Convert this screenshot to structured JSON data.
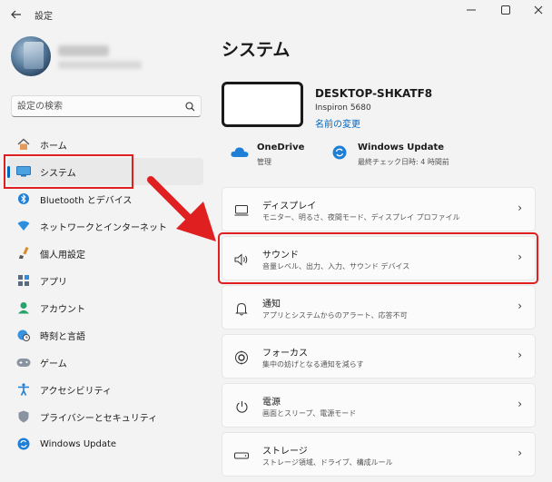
{
  "window": {
    "title": "設定"
  },
  "sidebar": {
    "search_placeholder": "設定の検索",
    "items": [
      {
        "label": "ホーム",
        "icon": "home-icon"
      },
      {
        "label": "システム",
        "icon": "system-icon"
      },
      {
        "label": "Bluetooth とデバイス",
        "icon": "bluetooth-icon"
      },
      {
        "label": "ネットワークとインターネット",
        "icon": "network-icon"
      },
      {
        "label": "個人用設定",
        "icon": "brush-icon"
      },
      {
        "label": "アプリ",
        "icon": "apps-icon"
      },
      {
        "label": "アカウント",
        "icon": "account-icon"
      },
      {
        "label": "時刻と言語",
        "icon": "globe-clock-icon"
      },
      {
        "label": "ゲーム",
        "icon": "gamepad-icon"
      },
      {
        "label": "アクセシビリティ",
        "icon": "accessibility-icon"
      },
      {
        "label": "プライバシーとセキュリティ",
        "icon": "shield-icon"
      },
      {
        "label": "Windows Update",
        "icon": "update-icon"
      }
    ]
  },
  "main": {
    "title": "システム",
    "device": {
      "name": "DESKTOP-SHKATF8",
      "model": "Inspiron 5680",
      "rename_link": "名前の変更"
    },
    "onedrive": {
      "title": "OneDrive",
      "subtitle": "管理"
    },
    "windows_update": {
      "title": "Windows Update",
      "subtitle": "最終チェック日時: 4 時間前"
    },
    "cards": [
      {
        "title": "ディスプレイ",
        "subtitle": "モニター、明るさ、夜間モード、ディスプレイ プロファイル",
        "icon": "display-icon"
      },
      {
        "title": "サウンド",
        "subtitle": "音量レベル、出力、入力、サウンド デバイス",
        "icon": "speaker-icon"
      },
      {
        "title": "通知",
        "subtitle": "アプリとシステムからのアラート、応答不可",
        "icon": "bell-icon"
      },
      {
        "title": "フォーカス",
        "subtitle": "集中の妨げとなる通知を減らす",
        "icon": "focus-icon"
      },
      {
        "title": "電源",
        "subtitle": "画面とスリープ、電源モード",
        "icon": "power-icon"
      },
      {
        "title": "ストレージ",
        "subtitle": "ストレージ領域、ドライブ、構成ルール",
        "icon": "storage-icon"
      }
    ]
  },
  "colors": {
    "accent": "#0067c0",
    "highlight": "#e02020"
  }
}
